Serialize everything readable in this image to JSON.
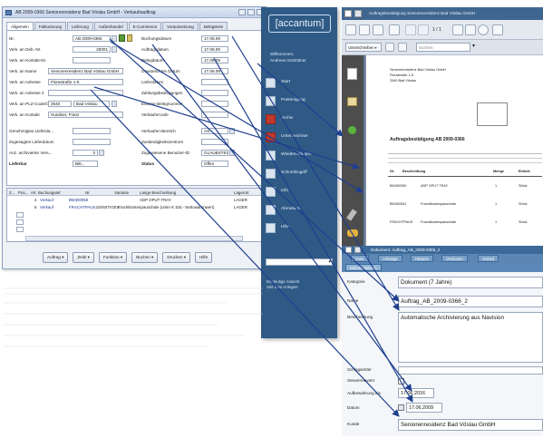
{
  "erp": {
    "title": "AB 2009-0366 Seniorenresidenz Bad Vöslau GmbH - Verkaufsauftrag",
    "tabs": [
      "Allgemein",
      "Fakturierung",
      "Lieferung",
      "Außenhandel",
      "E-Commerce",
      "Voraussetzung",
      "Belegtexte"
    ],
    "fields_left": [
      {
        "label": "Nr.",
        "value": "AB 2009-0366"
      },
      {
        "label": "Verk. an Deb.-Nr.",
        "value": "20001"
      },
      {
        "label": "Verk. an Kontakt-Nr.",
        "value": ""
      },
      {
        "label": "Verk. an Name",
        "value": "Seniorenresidenz Bad Vöslau GmbH"
      },
      {
        "label": "Verk. an Adresse",
        "value": "Florastraße 1-5"
      },
      {
        "label": "Verk. an Adresse 2",
        "value": ""
      },
      {
        "label": "Verk. an PLZ-Code/Ort",
        "value": "2540"
      },
      {
        "label": "Verk. an Kontakt",
        "value": "Hundser, Franz"
      },
      {
        "label": "Genehmigtes Lieferda...",
        "value": ""
      },
      {
        "label": "Zugesagtes Lieferdatum",
        "value": ""
      },
      {
        "label": "Anz. archivierter Vers...",
        "value": "0"
      },
      {
        "label": "Lieferbar",
        "value": "Bitt..."
      }
    ],
    "city_value": "Bad Vöslau",
    "fields_right": [
      {
        "label": "Buchungsdatum",
        "value": "17.06.09"
      },
      {
        "label": "Auftragsdatum",
        "value": "17.06.09"
      },
      {
        "label": "Belegdatum",
        "value": "17.06.09"
      },
      {
        "label": "Gewünschtes Datum",
        "value": "17.06.09"
      },
      {
        "label": "Lieferdatum",
        "value": ""
      },
      {
        "label": "Zahlungsbedingungen",
        "value": ""
      },
      {
        "label": "Externe Belegnummer",
        "value": ""
      },
      {
        "label": "Verkäufercode",
        "value": ""
      },
      {
        "label": "Verkaufen-Bereich",
        "value": "AS"
      },
      {
        "label": "Zuständigkeitszentrum",
        "value": ""
      },
      {
        "label": "Zugewiesene Benutzer-ID",
        "value": "GLAUBSTEIN"
      },
      {
        "label": "Status",
        "value": "Offen"
      }
    ],
    "grid_headers": [
      "Z...",
      "Pos...",
      "Art",
      "Buchungsart",
      "Nr.",
      "Variante",
      "Lange Beschreibung",
      "Lagerort"
    ],
    "grid_rows": [
      [
        "4",
        "Verkauf",
        "BM300050",
        "",
        "ADP OPUT TRAY",
        "LAGER"
      ],
      [
        "5",
        "Verkauf",
        "FRACHTPAUS...",
        "SONSTIGES",
        "Frachtkostenpauschale (unter € 150,- Nettowarenwert)",
        "LAGER"
      ]
    ],
    "buttons": [
      "Auftrag",
      "Zeile",
      "Funktion",
      "Buchen",
      "Drucken",
      "Hilfe"
    ]
  },
  "sidebar": {
    "logo": "[accantum]",
    "welcome_line1": "Willkommen,",
    "welcome_line2": "Andreas Gestöttner",
    "items": [
      "Start",
      "Postenigang",
      "Archiv",
      "Unterzeichner",
      "Wiedervorlagen",
      "Schnellzugriff",
      "Info",
      "Abmelden",
      "Hilfe"
    ],
    "folder_line1": "Eindeutige Ansicht",
    "folder_line2": "Seit dem Anlegen"
  },
  "viewer": {
    "title": "Auftragsbestätigung Seniorenresidenz Bad Vöslau GmbH",
    "page_counter": "1 / 1",
    "search_placeholder": "Suchen",
    "doc_heading": "Auftragsbestätigung AB 2009-0366",
    "page_lines": [
      "Seniorenresidenz Bad Vöslau GmbH",
      "Florastraße 1-5",
      "2540 Bad Vöslau"
    ],
    "table_headers": [
      "Nr.",
      "Beschreibung",
      "Menge",
      "Einheit"
    ],
    "table_rows": [
      [
        "BM300050",
        "ADP OPUT TRAY",
        "1",
        "Stück"
      ],
      [
        "BM300051",
        "Frachtkostenpauschale",
        "1",
        "Stück"
      ],
      [
        "FRACHTPAUS",
        "Frachtkostenpauschale",
        "1",
        "Stück"
      ]
    ]
  },
  "docwin": {
    "title": "Dokument: Auftrag_AB_2009-0366_2",
    "tabs": [
      "Seite",
      "Anhänge",
      "Hinweis",
      "Versionen",
      "Verlauf"
    ],
    "subtab": "Dokumentdaten",
    "fields": [
      {
        "label": "Kategorie",
        "value": "Dokument (7 Jahre)"
      },
      {
        "label": "Name",
        "value": "Auftrag_AB_2009-0366_2"
      },
      {
        "label": "Beschreibung",
        "value": "Automatische Archivierung aus Navision"
      },
      {
        "label": "Schlagwörter",
        "value": ""
      },
      {
        "label": "Steuerrelevant",
        "value": ""
      },
      {
        "label": "Aufbewahrung bis",
        "value": "17.06.2016"
      },
      {
        "label": "Datum",
        "value": "17.06.2009"
      },
      {
        "label": "Kunde",
        "value": "Seniorenresidenz Bad Vöslau GmbH"
      }
    ]
  },
  "colors": {
    "sidebar_bg": "#2f5a85",
    "arrow": "#1f3f8f",
    "accent_red": "#c0392b"
  }
}
